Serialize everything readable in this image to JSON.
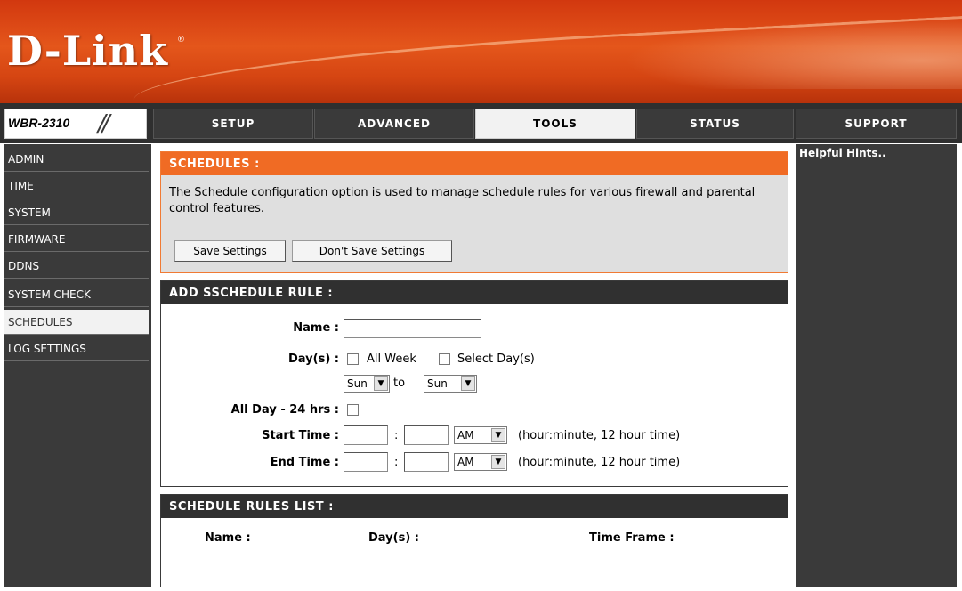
{
  "brand": {
    "logo": "D-Link",
    "registered": "®",
    "model": "WBR-2310",
    "model_slashes": "//"
  },
  "nav": {
    "tabs": [
      {
        "label": "SETUP"
      },
      {
        "label": "ADVANCED"
      },
      {
        "label": "TOOLS"
      },
      {
        "label": "STATUS"
      },
      {
        "label": "SUPPORT"
      }
    ],
    "active": "TOOLS"
  },
  "sidebar": {
    "items": [
      {
        "label": "ADMIN"
      },
      {
        "label": "TIME"
      },
      {
        "label": "SYSTEM"
      },
      {
        "label": "FIRMWARE"
      },
      {
        "label": "DDNS"
      },
      {
        "label": "SYSTEM CHECK"
      },
      {
        "label": "SCHEDULES"
      },
      {
        "label": "LOG SETTINGS"
      }
    ],
    "active": "SCHEDULES"
  },
  "schedules": {
    "title": "SCHEDULES :",
    "description": "The Schedule configuration option is used to manage schedule rules for various firewall and parental control features.",
    "save_label": "Save Settings",
    "dont_save_label": "Don't Save Settings"
  },
  "add_rule": {
    "title": "ADD SSCHEDULE RULE :",
    "name_label": "Name :",
    "name_value": "",
    "days_label": "Day(s) :",
    "all_week_label": "All Week",
    "select_days_label": "Select Day(s)",
    "from_day": "Sun",
    "to_label": "to",
    "to_day": "Sun",
    "all_day_label": "All Day - 24 hrs :",
    "start_label": "Start Time :",
    "end_label": "End Time :",
    "colon": ":",
    "start_ampm": "AM",
    "end_ampm": "AM",
    "time_hint": "(hour:minute, 12 hour time)"
  },
  "rules_list": {
    "title": "SCHEDULE RULES LIST :",
    "columns": {
      "name": "Name :",
      "days": "Day(s) :",
      "time_frame": "Time Frame :"
    }
  },
  "hints": {
    "title": "Helpful Hints.."
  }
}
